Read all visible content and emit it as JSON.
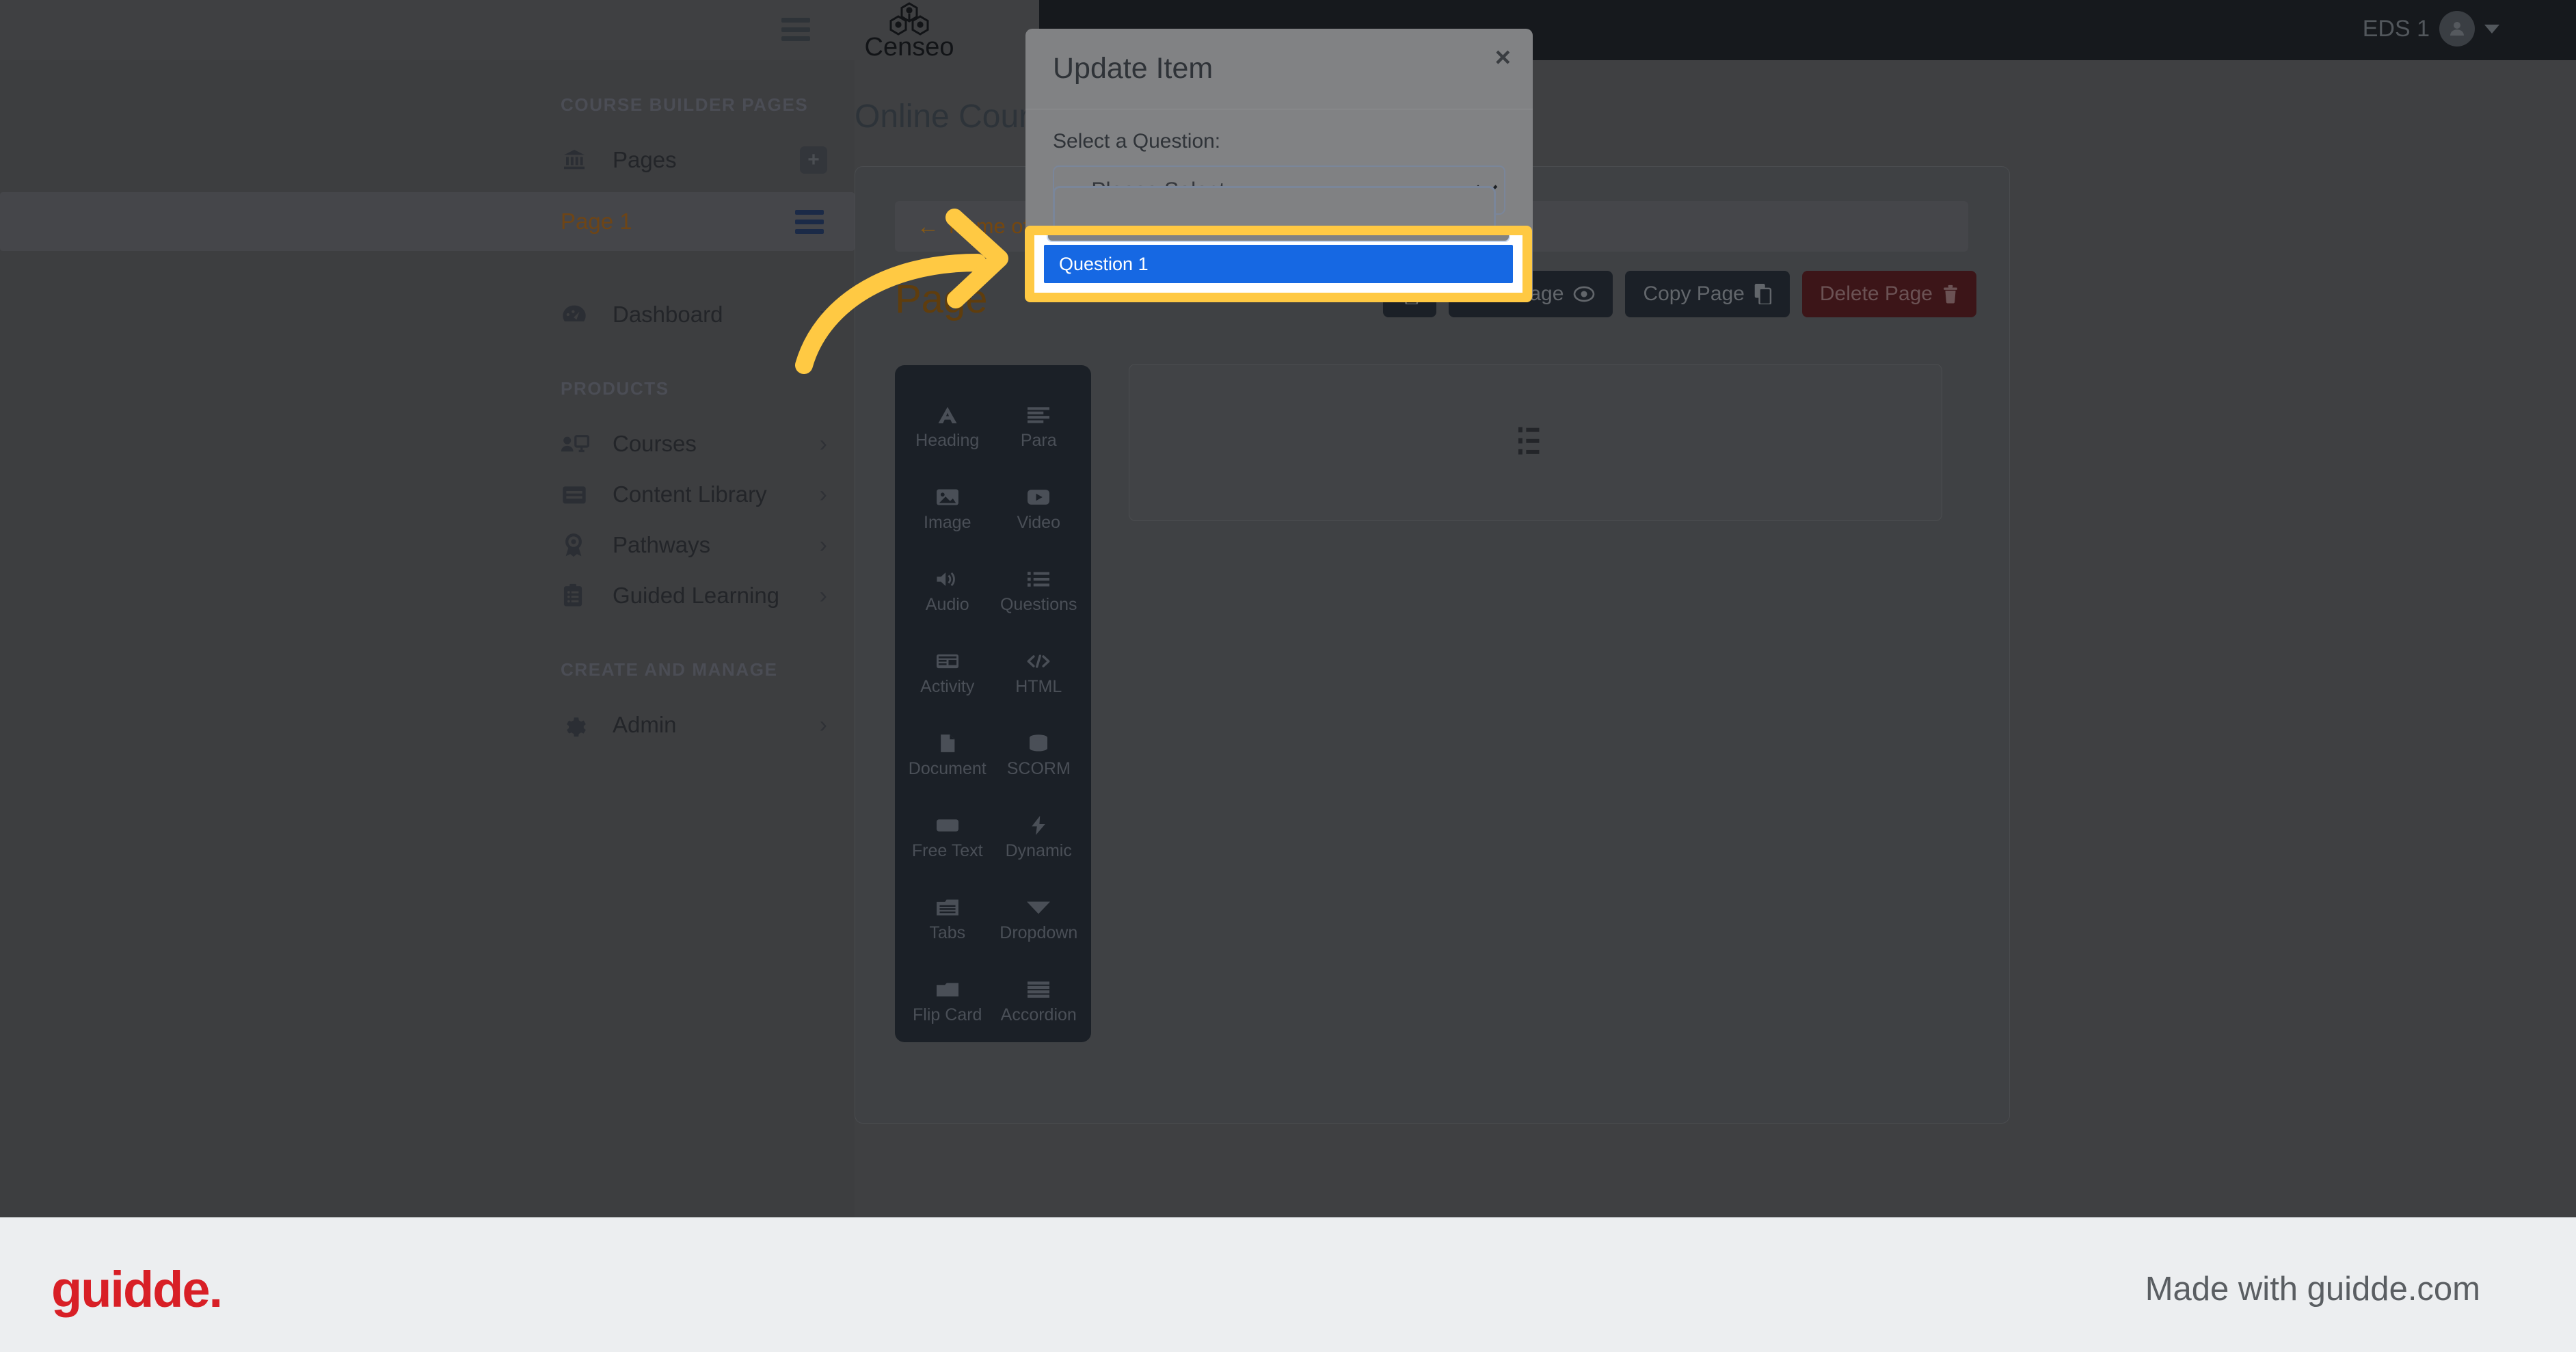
{
  "topbar": {
    "menu_icon": "hamburger-icon",
    "brand_name": "Censeo",
    "brand_logo_icon": "molecule-hexagon-logo",
    "user_name": "EDS 1",
    "avatar_icon": "user-avatar-icon",
    "caret_icon": "caret-down-icon"
  },
  "sidebar": {
    "sections": [
      {
        "label": "COURSE BUILDER PAGES"
      },
      {
        "label": "PRODUCTS"
      },
      {
        "label": "CREATE AND MANAGE"
      }
    ],
    "pages_row": {
      "label": "Pages",
      "icon": "bank-icon",
      "add_icon": "plus-icon"
    },
    "active_page": {
      "label": "Page 1",
      "handle_icon": "drag-handle-icon"
    },
    "dashboard": {
      "label": "Dashboard",
      "icon": "dashboard-gauge-icon",
      "chevron": "›"
    },
    "products": [
      {
        "label": "Courses",
        "icon": "courses-icon",
        "chevron": "›"
      },
      {
        "label": "Content Library",
        "icon": "content-library-icon",
        "chevron": "›"
      },
      {
        "label": "Pathways",
        "icon": "pathways-award-icon",
        "chevron": "›"
      },
      {
        "label": "Guided Learning",
        "icon": "guided-learning-clipboard-icon",
        "chevron": "›"
      }
    ],
    "manage": [
      {
        "label": "Admin",
        "icon": "gear-icon",
        "chevron": "›"
      }
    ]
  },
  "main": {
    "heading": "Online Course B",
    "breadcrumb": {
      "arrow": "←",
      "label": "Name of your c"
    },
    "page_title": "Page",
    "actions": [
      {
        "label": "View Page",
        "icon": "eye-icon",
        "style": "default"
      },
      {
        "label": "Copy Page",
        "icon": "copy-icon",
        "style": "default"
      },
      {
        "label": "Delete Page",
        "icon": "trash-icon",
        "style": "danger"
      }
    ],
    "palette": [
      {
        "label": "Heading",
        "icon": "heading-a-icon"
      },
      {
        "label": "Para",
        "icon": "paragraph-lines-icon"
      },
      {
        "label": "Image",
        "icon": "image-icon"
      },
      {
        "label": "Video",
        "icon": "video-icon"
      },
      {
        "label": "Audio",
        "icon": "audio-speaker-icon"
      },
      {
        "label": "Questions",
        "icon": "list-ul-icon"
      },
      {
        "label": "Activity",
        "icon": "activity-table-icon"
      },
      {
        "label": "HTML",
        "icon": "code-icon"
      },
      {
        "label": "Document",
        "icon": "document-icon"
      },
      {
        "label": "SCORM",
        "icon": "database-icon"
      },
      {
        "label": "Free Text",
        "icon": "free-text-icon"
      },
      {
        "label": "Dynamic",
        "icon": "bolt-icon"
      },
      {
        "label": "Tabs",
        "icon": "tabs-icon"
      },
      {
        "label": "Dropdown",
        "icon": "dropdown-triangle-icon"
      },
      {
        "label": "Flip Card",
        "icon": "flip-card-icon"
      },
      {
        "label": "Accordion",
        "icon": "accordion-lines-icon"
      }
    ],
    "drop_area_icon": "list-placeholder-icon"
  },
  "modal": {
    "title": "Update Item",
    "close_label": "×",
    "field_label": "Select a Question:",
    "select_value": "-- Please Select --",
    "options": [
      {
        "label": "",
        "selected": false
      },
      {
        "label": "Question 1",
        "selected": true
      }
    ]
  },
  "highlight": {
    "option_label": "Question 1",
    "border_color": "#ffc943",
    "selection_color": "#1668e3"
  },
  "footer": {
    "logo_text": "guidde.",
    "made_with": "Made with guidde.com",
    "logo_color": "#d81f26"
  }
}
